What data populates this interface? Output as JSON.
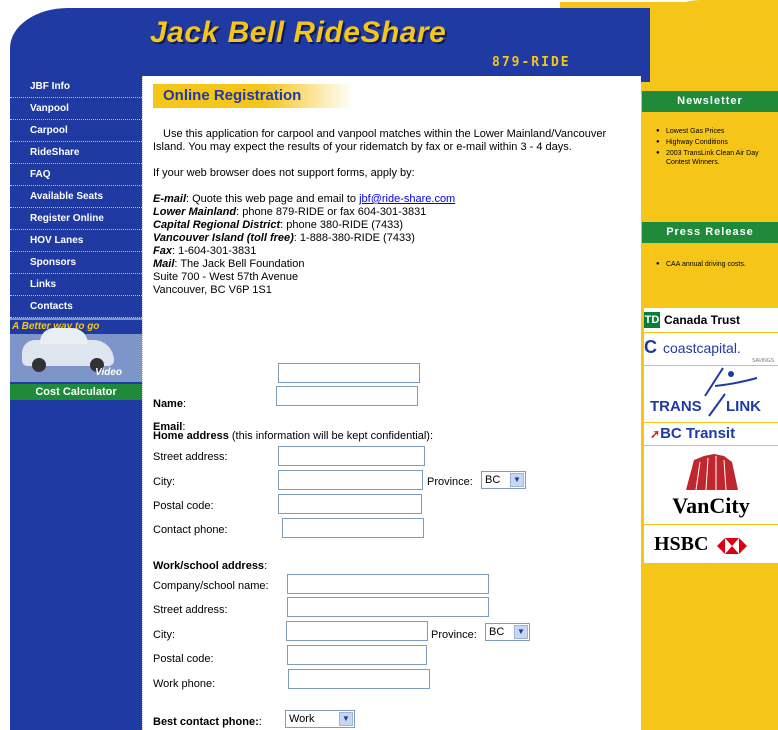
{
  "header": {
    "logo": "Jack Bell RideShare",
    "phone": "879-RIDE"
  },
  "nav": {
    "items": [
      "JBF Info",
      "Vanpool",
      "Carpool",
      "RideShare",
      "FAQ",
      "Available Seats",
      "Register Online",
      "HOV Lanes",
      "Sponsors",
      "Links",
      "Contacts"
    ],
    "promo_banner": "A Better way to go",
    "promo_video": "Video",
    "cost_calculator": "Cost Calculator"
  },
  "main": {
    "title": "Online Registration",
    "intro": "Use this application for carpool and vanpool matches within the Lower Mainland/Vancouver Island. You may expect the results of your ridematch by fax or e-mail within 3 - 4 days.",
    "no_forms": "If your web browser does not support forms, apply by:",
    "email_label": "E-mail",
    "email_text": ": Quote this web page and email to ",
    "email_address": "jbf@ride-share.com",
    "lower_mainland_label": "Lower Mainland",
    "lower_mainland_text": ": phone 879-RIDE or fax 604-301-3831",
    "crd_label": "Capital Regional District",
    "crd_text": ": phone 380-RIDE (7433)",
    "vi_label": "Vancouver Island (toll free)",
    "vi_text": ": 1-888-380-RIDE (7433)",
    "fax_label": "Fax",
    "fax_text": ": 1-604-301-3831",
    "mail_label": "Mail",
    "mail_text": ": The Jack Bell Foundation",
    "mail_line2": "Suite 700 - West 57th Avenue",
    "mail_line3": "Vancouver, BC V6P 1S1"
  },
  "form": {
    "name_label": "Name",
    "email_label": "Email",
    "home_heading": "Home address",
    "home_note": " (this information will be kept confidential):",
    "street_label": "Street address:",
    "city_label": "City:",
    "province_label": "Province:",
    "province_value": "BC",
    "postal_label": "Postal code:",
    "contact_phone_label": "Contact phone:",
    "work_heading": "Work/school address",
    "company_label": "Company/school name:",
    "work_street_label": "Street address:",
    "work_city_label": "City:",
    "work_province_label": "Province:",
    "work_province_value": "BC",
    "work_postal_label": "Postal code:",
    "work_phone_label": "Work phone:",
    "best_contact_label": "Best contact phone:",
    "best_contact_value": "Work"
  },
  "sidebar": {
    "newsletter_title": "Newsletter",
    "newsletter_items": [
      "Lowest Gas Prices",
      "Highway Conditions",
      "2003 TransLink Clean Air Day Contest Winners."
    ],
    "press_title": "Press Release",
    "press_items": [
      "CAA annual driving costs."
    ],
    "sponsors": {
      "td": "Canada Trust",
      "coast": "coastcapital.",
      "coast_sub": "SAVINGS",
      "translink_a": "TRANS",
      "translink_b": "LINK",
      "bctransit": "BC Transit",
      "vancity": "VanCity",
      "hsbc": "HSBC"
    }
  },
  "colors": {
    "blue": "#1f3ba3",
    "yellow": "#f5c518",
    "green": "#1f8b3a"
  }
}
